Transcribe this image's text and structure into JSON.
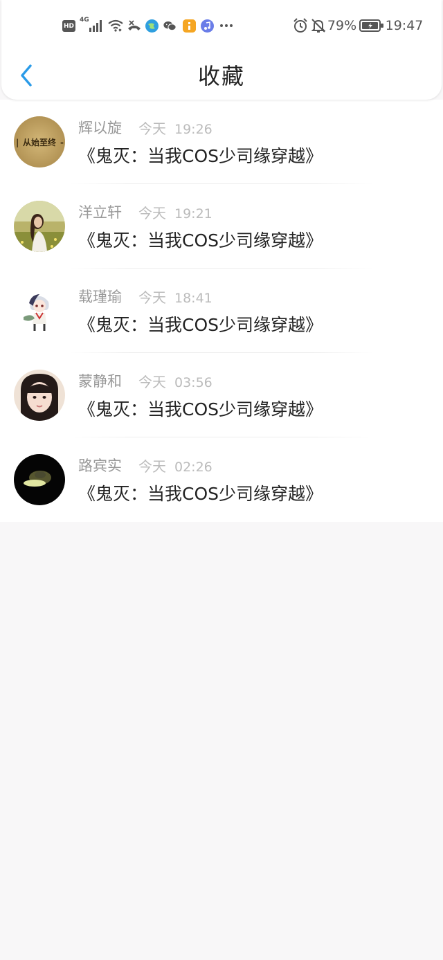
{
  "status_bar": {
    "hd": "HD",
    "network": "4G",
    "battery_percent": "79%",
    "time": "19:47",
    "icons": [
      "signal-icon",
      "wifi-icon",
      "call-off-icon",
      "browser-icon",
      "wechat-icon",
      "files-icon",
      "music-icon",
      "more-icon",
      "alarm-icon",
      "mute-icon",
      "battery-icon"
    ]
  },
  "header": {
    "title": "收藏",
    "back_icon": "chevron-left-icon",
    "accent_color": "#2a9be8"
  },
  "favorites": [
    {
      "name": "辉以旋",
      "day": "今天",
      "time": "19:26",
      "content": "《鬼灭：当我COS少司缘穿越》",
      "avatar": "text-sign-avatar",
      "avatar_text": "从始至终"
    },
    {
      "name": "洋立轩",
      "day": "今天",
      "time": "19:21",
      "content": "《鬼灭：当我COS少司缘穿越》",
      "avatar": "girl-in-field-avatar"
    },
    {
      "name": "载瑾瑜",
      "day": "今天",
      "time": "18:41",
      "content": "《鬼灭：当我COS少司缘穿越》",
      "avatar": "anime-character-avatar"
    },
    {
      "name": "蒙静和",
      "day": "今天",
      "time": "03:56",
      "content": "《鬼灭：当我COS少司缘穿越》",
      "avatar": "girl-portrait-avatar"
    },
    {
      "name": "路宾实",
      "day": "今天",
      "time": "02:26",
      "content": "《鬼灭：当我COS少司缘穿越》",
      "avatar": "dark-photo-avatar"
    }
  ]
}
